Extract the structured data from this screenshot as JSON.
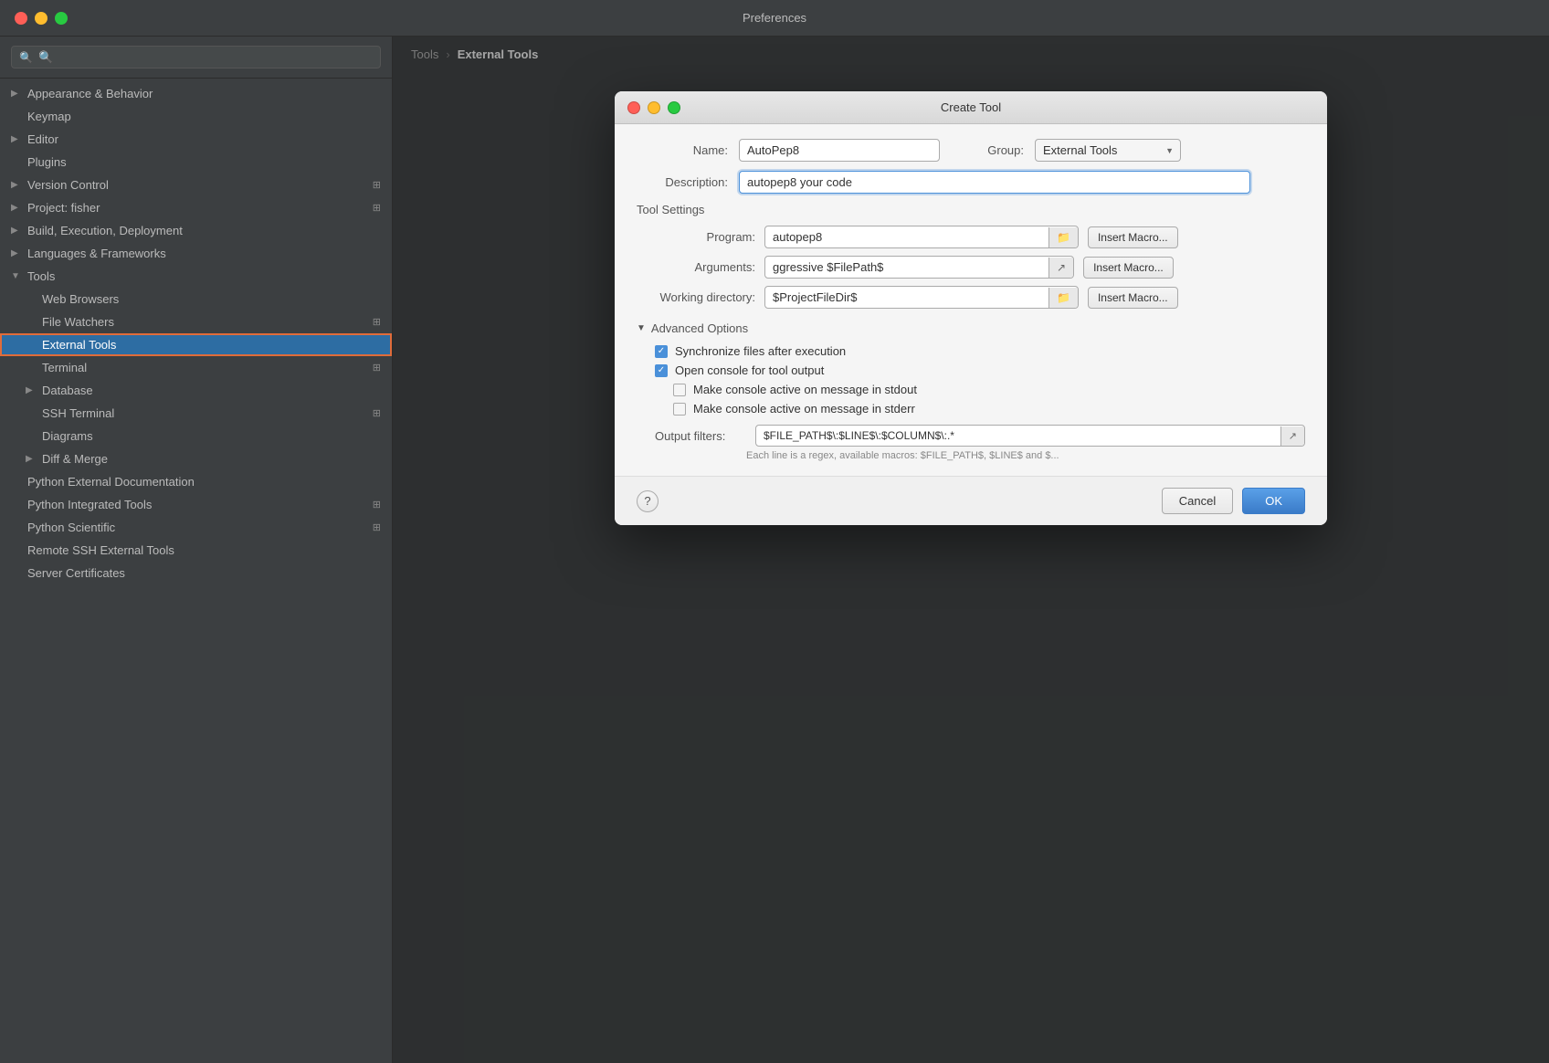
{
  "window": {
    "title": "Preferences"
  },
  "titlebar_buttons": {
    "close": "close",
    "minimize": "minimize",
    "maximize": "maximize"
  },
  "search": {
    "placeholder": "🔍",
    "value": ""
  },
  "sidebar": {
    "items": [
      {
        "id": "appearance-behavior",
        "label": "Appearance & Behavior",
        "type": "parent",
        "expanded": false,
        "indent": 0
      },
      {
        "id": "keymap",
        "label": "Keymap",
        "type": "leaf",
        "indent": 0
      },
      {
        "id": "editor",
        "label": "Editor",
        "type": "parent",
        "expanded": false,
        "indent": 0
      },
      {
        "id": "plugins",
        "label": "Plugins",
        "type": "leaf",
        "indent": 0
      },
      {
        "id": "version-control",
        "label": "Version Control",
        "type": "parent",
        "expanded": false,
        "indent": 0,
        "has_icon": true
      },
      {
        "id": "project-fisher",
        "label": "Project: fisher",
        "type": "parent",
        "expanded": false,
        "indent": 0,
        "has_icon": true
      },
      {
        "id": "build-execution-deployment",
        "label": "Build, Execution, Deployment",
        "type": "parent",
        "expanded": false,
        "indent": 0
      },
      {
        "id": "languages-frameworks",
        "label": "Languages & Frameworks",
        "type": "parent",
        "expanded": false,
        "indent": 0
      },
      {
        "id": "tools",
        "label": "Tools",
        "type": "parent",
        "expanded": true,
        "indent": 0
      },
      {
        "id": "web-browsers",
        "label": "Web Browsers",
        "type": "leaf",
        "indent": 1
      },
      {
        "id": "file-watchers",
        "label": "File Watchers",
        "type": "leaf",
        "indent": 1,
        "has_icon": true
      },
      {
        "id": "external-tools",
        "label": "External Tools",
        "type": "leaf",
        "indent": 1,
        "selected": true
      },
      {
        "id": "terminal",
        "label": "Terminal",
        "type": "leaf",
        "indent": 1,
        "has_icon": true
      },
      {
        "id": "database",
        "label": "Database",
        "type": "parent",
        "expanded": false,
        "indent": 1
      },
      {
        "id": "ssh-terminal",
        "label": "SSH Terminal",
        "type": "leaf",
        "indent": 1,
        "has_icon": true
      },
      {
        "id": "diagrams",
        "label": "Diagrams",
        "type": "leaf",
        "indent": 1
      },
      {
        "id": "diff-merge",
        "label": "Diff & Merge",
        "type": "parent",
        "expanded": false,
        "indent": 1
      },
      {
        "id": "python-external-documentation",
        "label": "Python External Documentation",
        "type": "leaf",
        "indent": 0
      },
      {
        "id": "python-integrated-tools",
        "label": "Python Integrated Tools",
        "type": "leaf",
        "indent": 0,
        "has_icon": true
      },
      {
        "id": "python-scientific",
        "label": "Python Scientific",
        "type": "leaf",
        "indent": 0,
        "has_icon": true
      },
      {
        "id": "remote-ssh-external-tools",
        "label": "Remote SSH External Tools",
        "type": "leaf",
        "indent": 0
      },
      {
        "id": "server-certificates",
        "label": "Server Certificates",
        "type": "leaf",
        "indent": 0
      }
    ]
  },
  "breadcrumb": {
    "parts": [
      "Tools",
      "External Tools"
    ],
    "separator": "›"
  },
  "dialog": {
    "title": "Create Tool",
    "name_label": "Name:",
    "name_value": "AutoPep8",
    "group_label": "Group:",
    "group_value": "External Tools",
    "description_label": "Description:",
    "description_value": "autopep8 your code",
    "tool_settings_label": "Tool Settings",
    "program_label": "Program:",
    "program_value": "autopep8",
    "arguments_label": "Arguments:",
    "arguments_value": "ggressive $FilePath$",
    "working_directory_label": "Working directory:",
    "working_directory_value": "$ProjectFileDir$",
    "insert_macro_label": "Insert Macro...",
    "advanced_options_label": "Advanced Options",
    "checkboxes": [
      {
        "id": "sync-files",
        "label": "Synchronize files after execution",
        "checked": true,
        "indent": 1
      },
      {
        "id": "open-console",
        "label": "Open console for tool output",
        "checked": true,
        "indent": 1
      },
      {
        "id": "console-active-stdout",
        "label": "Make console active on message in stdout",
        "checked": false,
        "indent": 2
      },
      {
        "id": "console-active-stderr",
        "label": "Make console active on message in stderr",
        "checked": false,
        "indent": 2
      }
    ],
    "output_filters_label": "Output filters:",
    "output_filters_value": "$FILE_PATH$\\:$LINE$\\:$COLUMN$\\:.*",
    "output_hint": "Each line is a regex, available macros: $FILE_PATH$, $LINE$ and $...",
    "help_button": "?",
    "cancel_button": "Cancel",
    "ok_button": "OK"
  }
}
